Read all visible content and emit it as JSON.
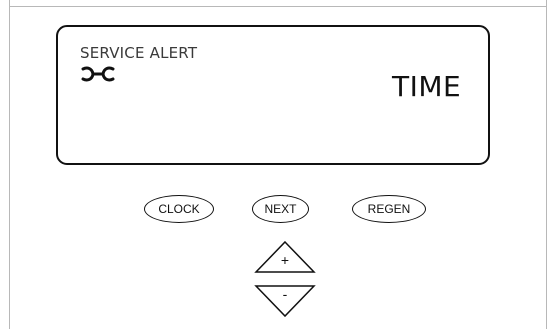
{
  "display": {
    "alert_label": "SERVICE ALERT",
    "service_icon": "wrench-icon",
    "main_text": "TIME"
  },
  "buttons": {
    "clock_label": "CLOCK",
    "next_label": "NEXT",
    "regen_label": "REGEN",
    "up_label": "+",
    "down_label": "-"
  }
}
